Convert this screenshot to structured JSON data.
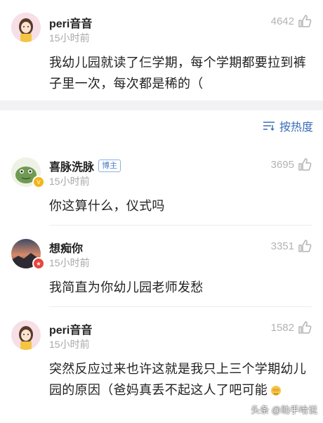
{
  "comments": [
    {
      "user": "peri音音",
      "time": "15小时前",
      "likes": "4642",
      "text": "我幼儿园就读了仨学期，每个学期都要拉到裤子里一次，每次都是稀的（"
    },
    {
      "user": "喜脉洗脉",
      "tag": "博主",
      "time": "15小时前",
      "likes": "3695",
      "text": "你这算什么，仪式吗"
    },
    {
      "user": "想痴你",
      "time": "15小时前",
      "likes": "3351",
      "text": "我简直为你幼儿园老师发愁"
    },
    {
      "user": "peri音音",
      "time": "15小时前",
      "likes": "1582",
      "text": "突然反应过来也许这就是我只上三个学期幼儿园的原因（爸妈真丢不起这人了吧可能"
    }
  ],
  "sort": {
    "label": "按热度"
  },
  "watermark": "头条 @助手哈说",
  "colors": {
    "link": "#3b6db8",
    "muted": "#a8a8a8",
    "background_gap": "#f2f2f4"
  }
}
